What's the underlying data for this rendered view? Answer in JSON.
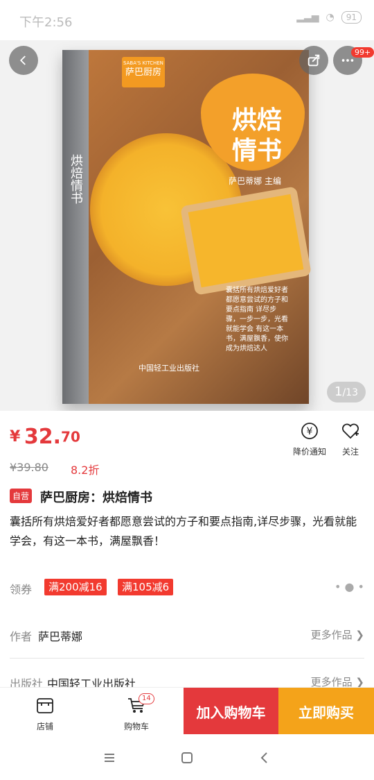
{
  "status": {
    "time": "下午2:56",
    "battery": "91"
  },
  "hero": {
    "cover_brand_en": "SABA'S KITCHEN",
    "cover_brand_cn": "萨巴厨房",
    "cover_title": "烘焙情书",
    "cover_author": "萨巴蒂娜 主编",
    "cover_spine": "烘焙情书",
    "cover_blurb": "囊括所有烘焙爱好者都愿意尝试的方子和要点指南 详尽步骤，一步一步，光看就能学会 有这一本书，满屋飘香，使你成为烘焙达人",
    "cover_publisher": "中国轻工业出版社",
    "page_current": "1",
    "page_total": "/13",
    "more_badge": "99+"
  },
  "price": {
    "symbol": "¥",
    "integer": "32.",
    "decimal": "70",
    "original": "¥39.80",
    "discount": "8.2折"
  },
  "actions": {
    "notify": "降价通知",
    "follow": "关注"
  },
  "product": {
    "self_tag": "自营",
    "title": "萨巴厨房：烘焙情书",
    "description": "囊括所有烘焙爱好者都愿意尝试的方子和要点指南,详尽步骤，光看就能学会，有这一本书，满屋飘香！"
  },
  "coupons": {
    "label": "领券",
    "items": [
      "满200减16",
      "满105减6"
    ],
    "more": "• ● •"
  },
  "author": {
    "label": "作者",
    "value": "萨巴蒂娜",
    "more": "更多作品 ❯"
  },
  "publisher": {
    "label": "出版社",
    "value": "中国轻工业出版社",
    "more": "更多作品 ❯"
  },
  "bottom": {
    "shop": "店铺",
    "cart": "购物车",
    "cart_count": "14",
    "add_cart": "加入购物车",
    "buy_now": "立即购买"
  },
  "colors": {
    "accent": "#e4393c",
    "buy": "#f4a31a"
  }
}
